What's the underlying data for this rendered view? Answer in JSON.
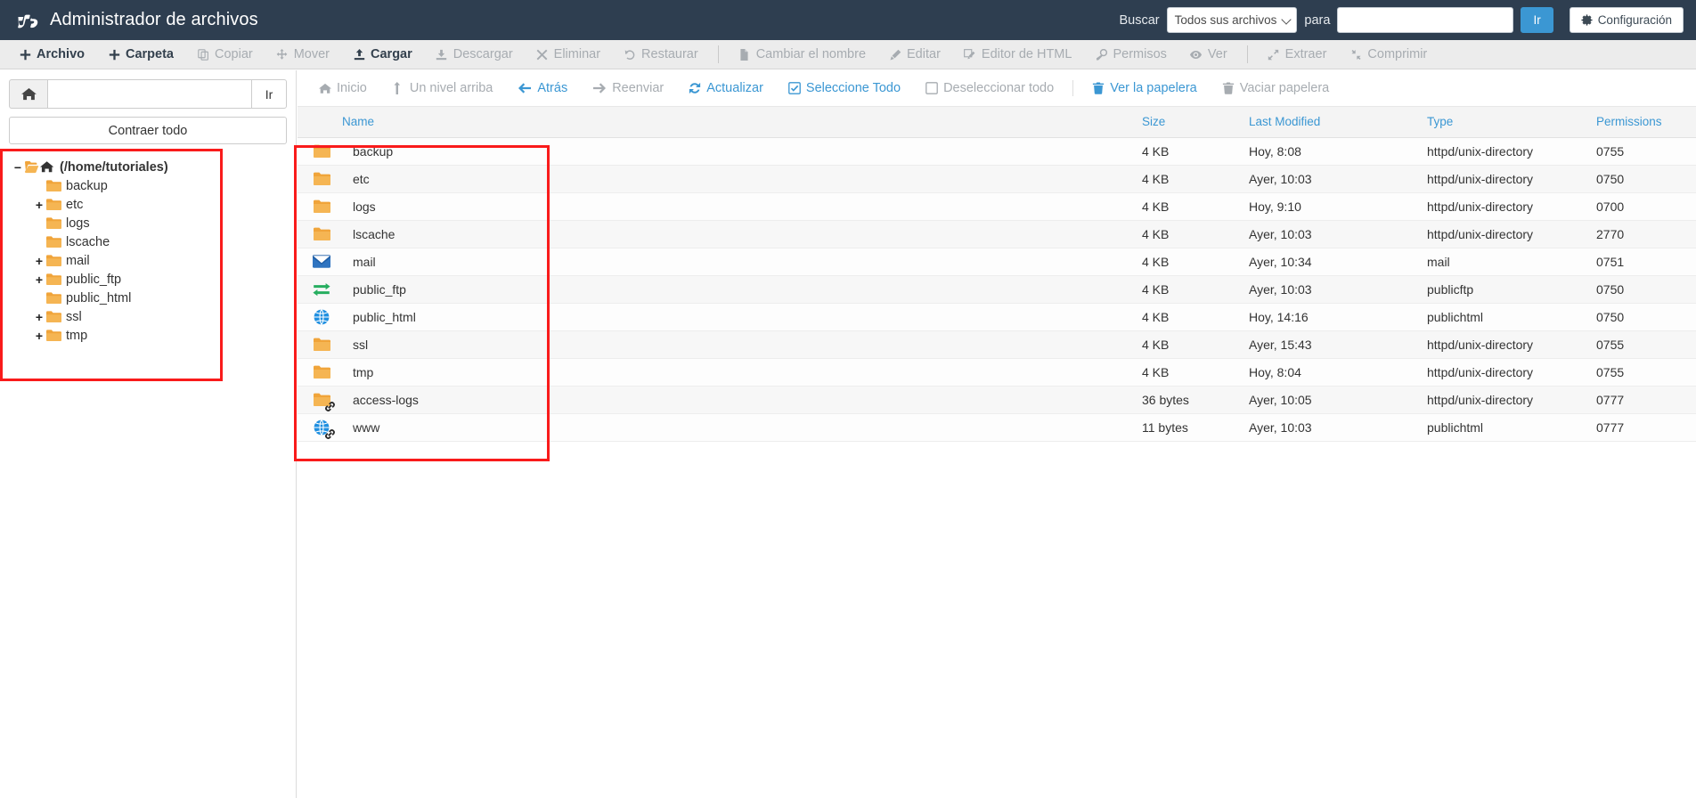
{
  "header": {
    "title": "Administrador de archivos",
    "logo_icon": "cpanel-logo-icon",
    "search_label": "Buscar",
    "search_scope": "Todos sus archivos",
    "search_for_label": "para",
    "search_value": "",
    "search_placeholder": "",
    "go_label": "Ir",
    "settings_label": "Configuración",
    "settings_icon": "gear-icon",
    "bg_color": "#2e3e50"
  },
  "toolbar": {
    "items": [
      {
        "label": "Archivo",
        "icon": "plus-icon",
        "enabled": true
      },
      {
        "label": "Carpeta",
        "icon": "plus-icon",
        "enabled": true
      },
      {
        "label": "Copiar",
        "icon": "copy-icon",
        "enabled": false
      },
      {
        "label": "Mover",
        "icon": "move-icon",
        "enabled": false
      },
      {
        "label": "Cargar",
        "icon": "upload-icon",
        "enabled": true
      },
      {
        "label": "Descargar",
        "icon": "download-icon",
        "enabled": false
      },
      {
        "label": "Eliminar",
        "icon": "times-icon",
        "enabled": false
      },
      {
        "label": "Restaurar",
        "icon": "undo-icon",
        "enabled": false
      },
      {
        "label": "Cambiar el nombre",
        "icon": "file-icon",
        "enabled": false
      },
      {
        "label": "Editar",
        "icon": "pencil-icon",
        "enabled": false
      },
      {
        "label": "Editor de HTML",
        "icon": "html-editor-icon",
        "enabled": false
      },
      {
        "label": "Permisos",
        "icon": "key-icon",
        "enabled": false
      },
      {
        "label": "Ver",
        "icon": "eye-icon",
        "enabled": false
      },
      {
        "label": "Extraer",
        "icon": "expand-icon",
        "enabled": false
      },
      {
        "label": "Comprimir",
        "icon": "compress-icon",
        "enabled": false
      }
    ]
  },
  "sidebar": {
    "home_icon": "home-icon",
    "path_value": "",
    "path_placeholder": "",
    "go_label": "Ir",
    "collapse_label": "Contraer todo",
    "tree": [
      {
        "label": "(/home/tutoriales)",
        "toggle": "minus",
        "depth": 0,
        "icon": "folder-open-home-icon",
        "root": true
      },
      {
        "label": "backup",
        "toggle": "none",
        "depth": 1,
        "icon": "folder-icon"
      },
      {
        "label": "etc",
        "toggle": "plus",
        "depth": 1,
        "icon": "folder-icon"
      },
      {
        "label": "logs",
        "toggle": "none",
        "depth": 1,
        "icon": "folder-icon"
      },
      {
        "label": "lscache",
        "toggle": "none",
        "depth": 1,
        "icon": "folder-icon"
      },
      {
        "label": "mail",
        "toggle": "plus",
        "depth": 1,
        "icon": "folder-icon"
      },
      {
        "label": "public_ftp",
        "toggle": "plus",
        "depth": 1,
        "icon": "folder-icon"
      },
      {
        "label": "public_html",
        "toggle": "none",
        "depth": 1,
        "icon": "folder-icon"
      },
      {
        "label": "ssl",
        "toggle": "plus",
        "depth": 1,
        "icon": "folder-icon"
      },
      {
        "label": "tmp",
        "toggle": "plus",
        "depth": 1,
        "icon": "folder-icon"
      }
    ]
  },
  "navbar": {
    "items": [
      {
        "label": "Inicio",
        "icon": "home-icon",
        "active": false
      },
      {
        "label": "Un nivel arriba",
        "icon": "level-up-icon",
        "active": false
      },
      {
        "label": "Atrás",
        "icon": "arrow-left-icon",
        "active": true
      },
      {
        "label": "Reenviar",
        "icon": "arrow-right-icon",
        "active": false
      },
      {
        "label": "Actualizar",
        "icon": "refresh-icon",
        "active": true
      },
      {
        "label": "Seleccione Todo",
        "icon": "checkbox-checked-icon",
        "active": true
      },
      {
        "label": "Deseleccionar todo",
        "icon": "checkbox-empty-icon",
        "active": false
      },
      {
        "label": "Ver la papelera",
        "icon": "trash-icon",
        "active": true,
        "sep_before": true
      },
      {
        "label": "Vaciar papelera",
        "icon": "trash-icon",
        "active": false
      }
    ]
  },
  "table": {
    "columns": [
      "Name",
      "Size",
      "Last Modified",
      "Type",
      "Permissions"
    ],
    "rows": [
      {
        "name": "backup",
        "icon": "folder-icon",
        "link": false,
        "size": "4 KB",
        "modified": "Hoy, 8:08",
        "type": "httpd/unix-directory",
        "permissions": "0755"
      },
      {
        "name": "etc",
        "icon": "folder-icon",
        "link": false,
        "size": "4 KB",
        "modified": "Ayer, 10:03",
        "type": "httpd/unix-directory",
        "permissions": "0750"
      },
      {
        "name": "logs",
        "icon": "folder-icon",
        "link": false,
        "size": "4 KB",
        "modified": "Hoy, 9:10",
        "type": "httpd/unix-directory",
        "permissions": "0700"
      },
      {
        "name": "lscache",
        "icon": "folder-icon",
        "link": false,
        "size": "4 KB",
        "modified": "Ayer, 10:03",
        "type": "httpd/unix-directory",
        "permissions": "2770"
      },
      {
        "name": "mail",
        "icon": "envelope-icon",
        "link": false,
        "size": "4 KB",
        "modified": "Ayer, 10:34",
        "type": "mail",
        "permissions": "0751"
      },
      {
        "name": "public_ftp",
        "icon": "exchange-icon",
        "link": false,
        "size": "4 KB",
        "modified": "Ayer, 10:03",
        "type": "publicftp",
        "permissions": "0750"
      },
      {
        "name": "public_html",
        "icon": "globe-icon",
        "link": false,
        "size": "4 KB",
        "modified": "Hoy, 14:16",
        "type": "publichtml",
        "permissions": "0750"
      },
      {
        "name": "ssl",
        "icon": "folder-icon",
        "link": false,
        "size": "4 KB",
        "modified": "Ayer, 15:43",
        "type": "httpd/unix-directory",
        "permissions": "0755"
      },
      {
        "name": "tmp",
        "icon": "folder-icon",
        "link": false,
        "size": "4 KB",
        "modified": "Hoy, 8:04",
        "type": "httpd/unix-directory",
        "permissions": "0755"
      },
      {
        "name": "access-logs",
        "icon": "folder-icon",
        "link": true,
        "size": "36 bytes",
        "modified": "Ayer, 10:05",
        "type": "httpd/unix-directory",
        "permissions": "0777"
      },
      {
        "name": "www",
        "icon": "globe-icon",
        "link": true,
        "size": "11 bytes",
        "modified": "Ayer, 10:03",
        "type": "publichtml",
        "permissions": "0777"
      }
    ]
  },
  "annotations": {
    "color": "#f91b1b",
    "boxes": [
      "sidebar-tree-highlight",
      "file-name-column-highlight"
    ]
  }
}
